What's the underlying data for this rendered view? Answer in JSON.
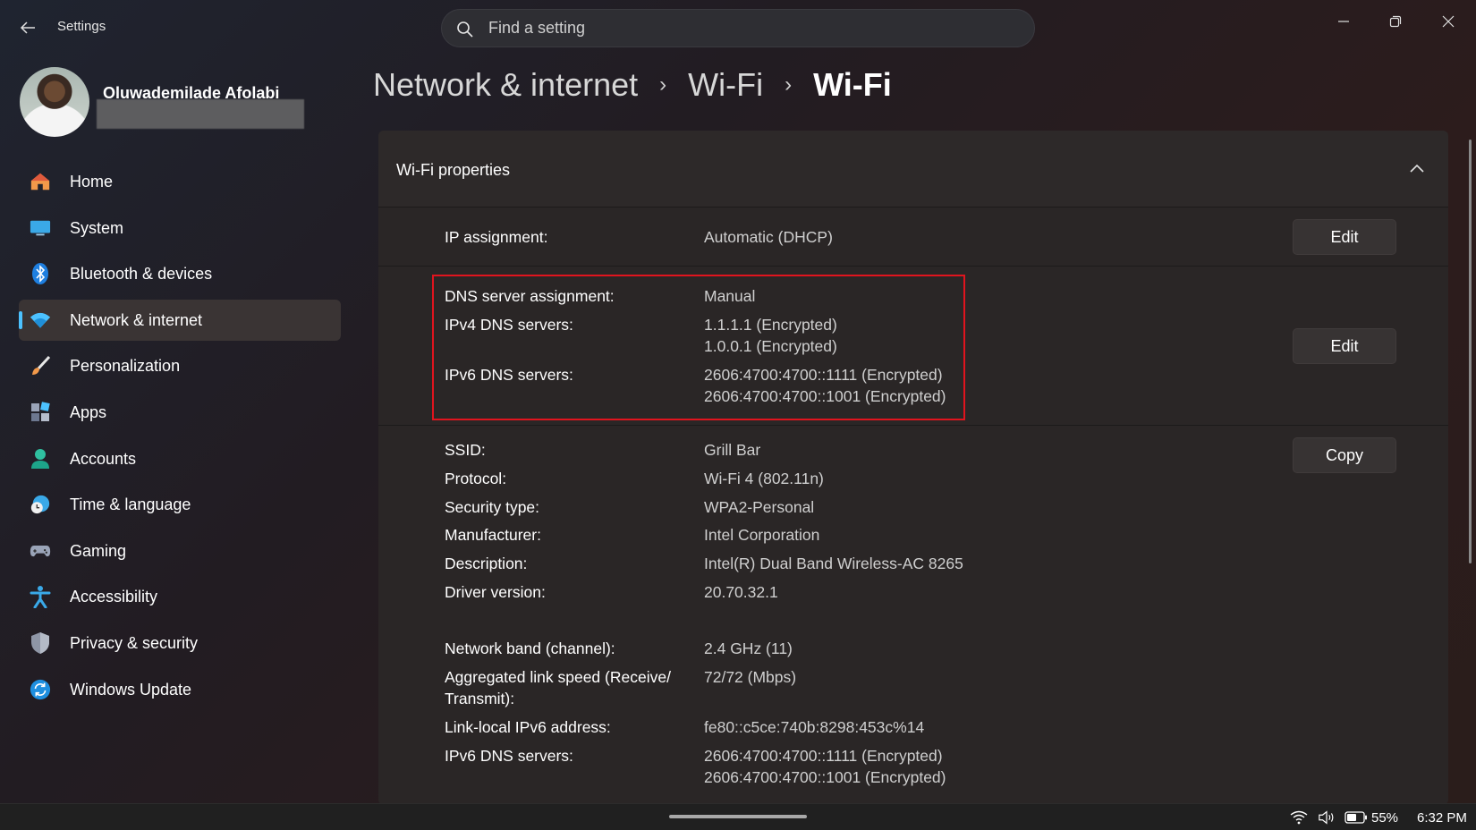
{
  "app": {
    "title": "Settings"
  },
  "search": {
    "placeholder": "Find a setting"
  },
  "profile": {
    "name": "Oluwademilade Afolabi"
  },
  "nav": {
    "items": [
      {
        "label": "Home",
        "icon": "home-icon"
      },
      {
        "label": "System",
        "icon": "system-icon"
      },
      {
        "label": "Bluetooth & devices",
        "icon": "bluetooth-icon"
      },
      {
        "label": "Network & internet",
        "icon": "wifi-icon",
        "active": true
      },
      {
        "label": "Personalization",
        "icon": "brush-icon"
      },
      {
        "label": "Apps",
        "icon": "apps-icon"
      },
      {
        "label": "Accounts",
        "icon": "accounts-icon"
      },
      {
        "label": "Time & language",
        "icon": "time-language-icon"
      },
      {
        "label": "Gaming",
        "icon": "gamepad-icon"
      },
      {
        "label": "Accessibility",
        "icon": "accessibility-icon"
      },
      {
        "label": "Privacy & security",
        "icon": "shield-icon"
      },
      {
        "label": "Windows Update",
        "icon": "update-icon"
      }
    ]
  },
  "breadcrumb": [
    "Network & internet",
    "Wi-Fi",
    "Wi-Fi"
  ],
  "panel": {
    "title": "Wi-Fi properties",
    "ip": {
      "label": "IP assignment:",
      "value": "Automatic (DHCP)",
      "button": "Edit"
    },
    "dns": {
      "assignment_label": "DNS server assignment:",
      "assignment_value": "Manual",
      "ipv4_label": "IPv4 DNS servers:",
      "ipv4_values": [
        "1.1.1.1 (Encrypted)",
        "1.0.0.1 (Encrypted)"
      ],
      "ipv6_label": "IPv6 DNS servers:",
      "ipv6_values": [
        "2606:4700:4700::1111 (Encrypted)",
        "2606:4700:4700::1001 (Encrypted)"
      ],
      "button": "Edit"
    },
    "props": {
      "button": "Copy",
      "ssid_label": "SSID:",
      "ssid_value": "Grill Bar",
      "protocol_label": "Protocol:",
      "protocol_value": "Wi-Fi 4 (802.11n)",
      "security_label": "Security type:",
      "security_value": "WPA2-Personal",
      "manufacturer_label": "Manufacturer:",
      "manufacturer_value": "Intel Corporation",
      "description_label": "Description:",
      "description_value": "Intel(R) Dual Band Wireless-AC 8265",
      "driver_label": "Driver version:",
      "driver_value": "20.70.32.1",
      "band_label": "Network band (channel):",
      "band_value": "2.4 GHz (11)",
      "speed_label_1": "Aggregated link speed (Receive/",
      "speed_label_2": "Transmit):",
      "speed_value": "72/72 (Mbps)",
      "linklocal_label": "Link-local IPv6 address:",
      "linklocal_value": "fe80::c5ce:740b:8298:453c%14",
      "ipv6dns_label": "IPv6 DNS servers:",
      "ipv6dns_value_1": "2606:4700:4700::1111 (Encrypted)",
      "ipv6dns_value_2": "2606:4700:4700::1001 (Encrypted)"
    }
  },
  "taskbar": {
    "battery": "55%",
    "time": "6:32 PM"
  },
  "colors": {
    "accent": "#4cc2ff",
    "highlight": "#e0141e"
  }
}
